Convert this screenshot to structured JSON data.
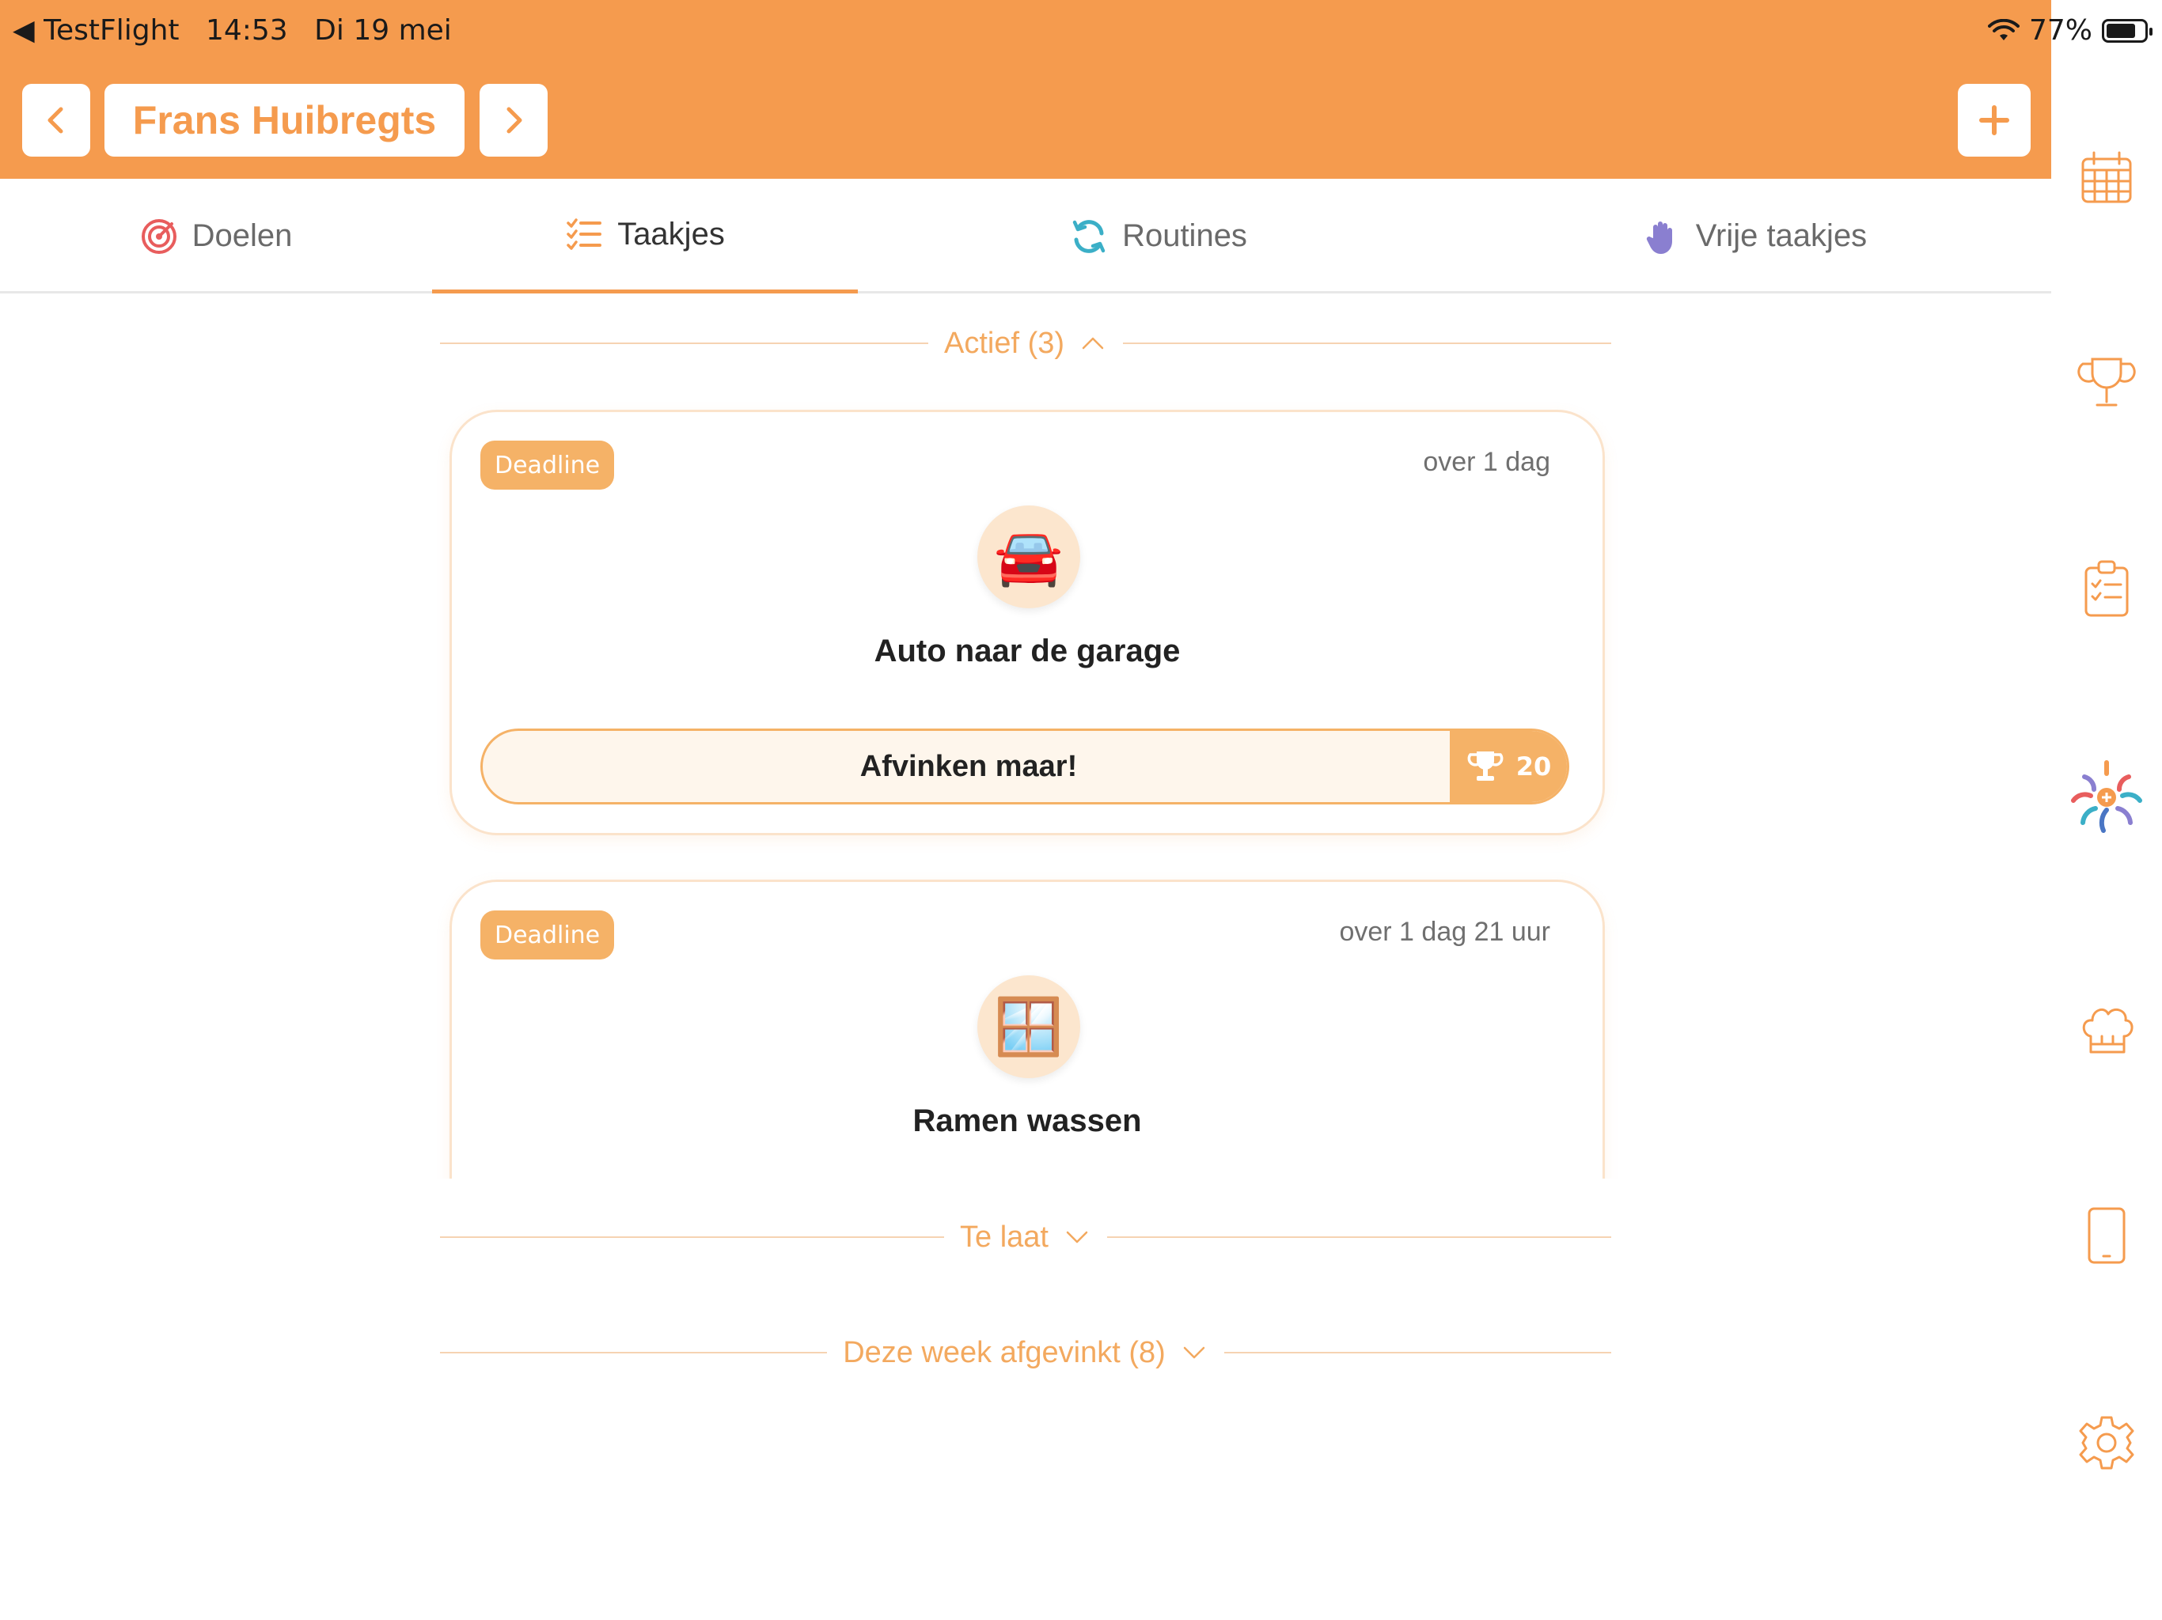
{
  "status_bar": {
    "back_app": "◀ TestFlight",
    "time": "14:53",
    "date": "Di 19 mei",
    "battery": "77%"
  },
  "header": {
    "person_name": "Frans Huibregts",
    "add_icon": "plus-icon",
    "prev_icon": "chevron-left-icon",
    "next_icon": "chevron-right-icon"
  },
  "tabs": [
    {
      "label": "Doelen",
      "icon": "target-icon"
    },
    {
      "label": "Taakjes",
      "icon": "checklist-icon",
      "active": true
    },
    {
      "label": "Routines",
      "icon": "refresh-icon"
    },
    {
      "label": "Vrije taakjes",
      "icon": "hand-icon"
    }
  ],
  "sections": {
    "active": "Actief (3)",
    "late": "Te laat",
    "week": "Deze week afgevinkt (8)"
  },
  "tasks": [
    {
      "badge": "Deadline",
      "due": "over 1 dag",
      "emoji": "🚘",
      "title": "Auto naar de garage",
      "action": "Afvinken maar!",
      "points": "20"
    },
    {
      "badge": "Deadline",
      "due": "over 1 dag 21 uur",
      "emoji": "🪟",
      "title": "Ramen wassen"
    }
  ],
  "sidebar": [
    "calendar-icon",
    "trophy-icon",
    "clipboard-icon",
    "app-logo-icon",
    "chef-hat-icon",
    "tablet-icon",
    "gear-icon"
  ],
  "colors": {
    "brand": "#F59B4E",
    "badge": "#F5B267",
    "section_text": "#F3A95F"
  }
}
